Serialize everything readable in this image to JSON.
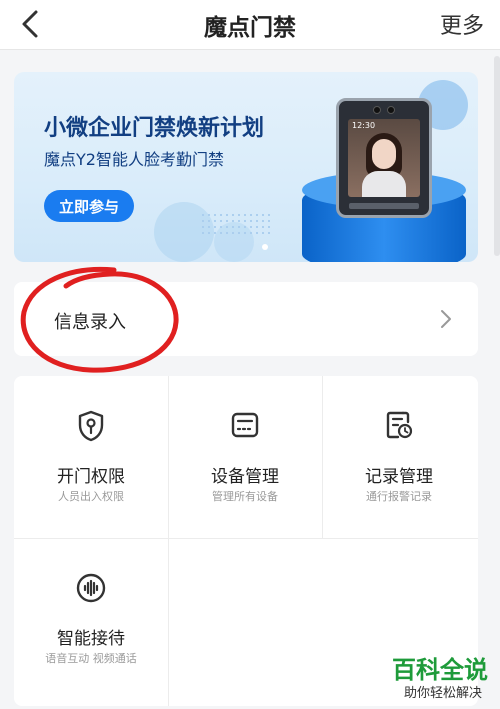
{
  "header": {
    "title": "魔点门禁",
    "more_label": "更多"
  },
  "banner": {
    "title": "小微企业门禁焕新计划",
    "subtitle": "魔点Y2智能人脸考勤门禁",
    "cta_label": "立即参与",
    "device_time": "12:30"
  },
  "info_row": {
    "label": "信息录入"
  },
  "grid": {
    "items": [
      {
        "title": "开门权限",
        "subtitle": "人员出入权限",
        "icon": "shield-key-icon"
      },
      {
        "title": "设备管理",
        "subtitle": "管理所有设备",
        "icon": "device-icon"
      },
      {
        "title": "记录管理",
        "subtitle": "通行报警记录",
        "icon": "record-clock-icon"
      },
      {
        "title": "智能接待",
        "subtitle": "语音互动 视频通话",
        "icon": "voice-wave-icon"
      }
    ]
  },
  "watermark": {
    "title": "百科全说",
    "subtitle": "助你轻松解决"
  },
  "colors": {
    "accent": "#1a7cf0",
    "banner_text": "#123f82",
    "annotation": "#e02020",
    "watermark": "#1e9b3a"
  }
}
